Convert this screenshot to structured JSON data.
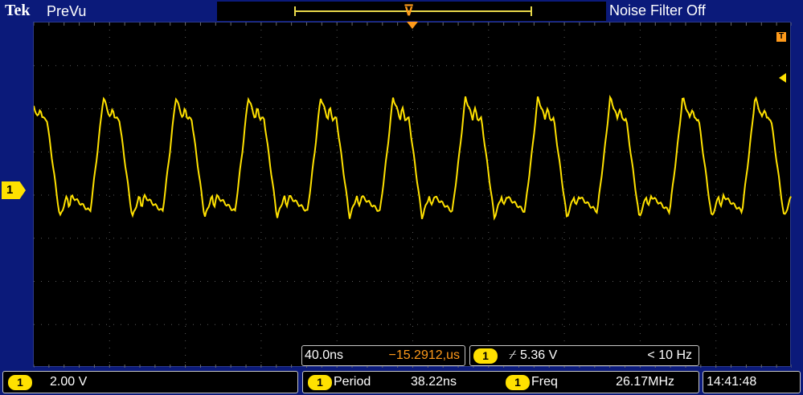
{
  "header": {
    "brand": "Tek",
    "mode": "PreVu",
    "noise_filter": "Noise Filter Off"
  },
  "waveform": {
    "channel": "1",
    "trace_color": "#ffe100",
    "period_ns": 38.22,
    "time_per_div_ns": 40.0
  },
  "timebase": {
    "scale": "40.0ns",
    "offset": "−15.2912,us"
  },
  "trigger": {
    "channel": "1",
    "slope_level": "⌿ 5.36 V",
    "frequency": "< 10 Hz"
  },
  "status": {
    "channel": "1",
    "volts_per_div": "2.00 V",
    "meas1_channel": "1",
    "meas1_label": "Period",
    "meas1_value": "38.22ns",
    "meas2_channel": "1",
    "meas2_label": "Freq",
    "meas2_value": "26.17MHz",
    "clock": "14:41:48"
  },
  "colors": {
    "background": "#0b1a7a",
    "accent_orange": "#ff9a1a",
    "ch1_yellow": "#ffe100"
  }
}
